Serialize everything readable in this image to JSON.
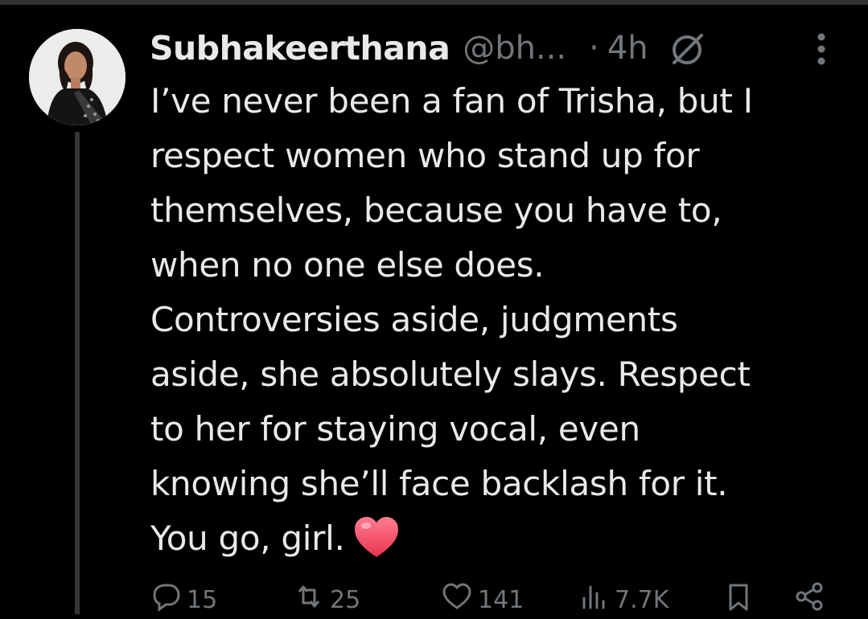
{
  "tweet": {
    "author_name": "Subhakeerthana",
    "handle": "@bh...",
    "separator": "·",
    "timestamp": "4h",
    "muted_icon": "mute-icon",
    "more_icon": "more-options-icon",
    "text_lines": [
      "I’ve never been a fan of Trisha, but I",
      "respect women who stand up for",
      "themselves, because you have to,",
      "when no one else does.",
      "Controversies aside, judgments",
      "aside, she absolutely slays. Respect",
      "to her for staying vocal, even",
      "knowing she’ll face backlash for it.",
      "You go, girl."
    ],
    "emoji": "heart-emoji"
  },
  "actions": {
    "replies": {
      "icon": "reply-icon",
      "count": "15"
    },
    "retweets": {
      "icon": "retweet-icon",
      "count": "25"
    },
    "likes": {
      "icon": "like-icon",
      "count": "141"
    },
    "views": {
      "icon": "views-icon",
      "count": "7.7K"
    },
    "bookmark": {
      "icon": "bookmark-icon"
    },
    "share": {
      "icon": "share-icon"
    }
  },
  "colors": {
    "background": "#000000",
    "text_primary": "#e7e9ea",
    "text_secondary": "#71767b",
    "thread_line": "#333639",
    "heart": "#f0506e"
  }
}
